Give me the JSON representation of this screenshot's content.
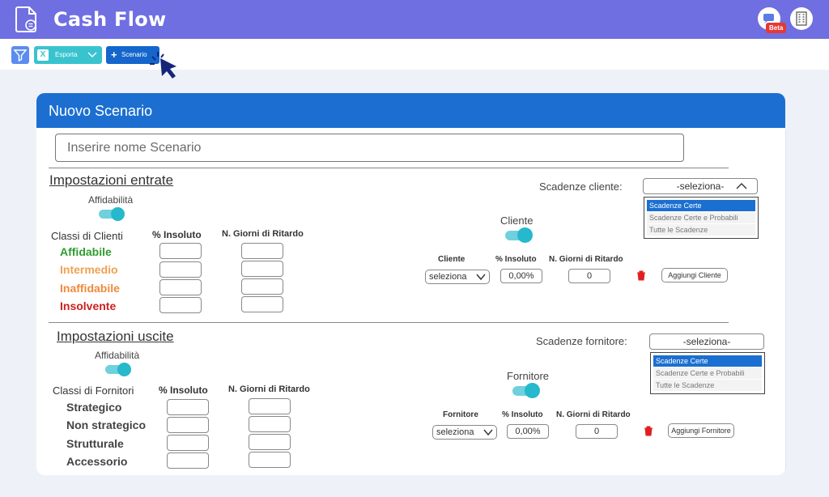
{
  "app": {
    "title": "Cash Flow",
    "beta_badge": "Beta"
  },
  "toolbar": {
    "export_label": "Esporta",
    "scenario_label": "Scenario"
  },
  "modal": {
    "title": "Nuovo Scenario",
    "name_placeholder": "Inserire nome Scenario",
    "entrate": {
      "heading": "Impostazioni entrate",
      "affidabilita_label": "Affidabilità",
      "col_classes": "Classi di Clienti",
      "col_insoluto": "% Insoluto",
      "col_ritardo": "N. Giorni di Ritardo",
      "classes": [
        "Affidabile",
        "Intermedio",
        "Inaffidabile",
        "Insolvente"
      ],
      "scadenze_label": "Scadenze cliente:",
      "scadenze_select": "-seleziona-",
      "scadenze_options": [
        "Scadenze Certe",
        "Scadenze Certe e Probabili",
        "Tutte le Scadenze"
      ],
      "party_label": "Cliente",
      "row_col_party": "Cliente",
      "row_col_insoluto": "% Insoluto",
      "row_col_ritardo": "N. Giorni di Ritardo",
      "row_select": "seleziona",
      "row_insoluto_value": "0,00%",
      "row_ritardo_value": "0",
      "add_label": "Aggiungi Cliente"
    },
    "uscite": {
      "heading": "Impostazioni uscite",
      "affidabilita_label": "Affidabilità",
      "col_classes": "Classi di Fornitori",
      "col_insoluto": "% Insoluto",
      "col_ritardo": "N. Giorni di Ritardo",
      "classes": [
        "Strategico",
        "Non strategico",
        "Strutturale",
        "Accessorio"
      ],
      "scadenze_label": "Scadenze fornitore:",
      "scadenze_select": "-seleziona-",
      "scadenze_options": [
        "Scadenze Certe",
        "Scadenze Certe e Probabili",
        "Tutte le Scadenze"
      ],
      "party_label": "Fornitore",
      "row_col_party": "Fornitore",
      "row_col_insoluto": "% Insoluto",
      "row_col_ritardo": "N. Giorni di Ritardo",
      "row_select": "seleziona",
      "row_insoluto_value": "0,00%",
      "row_ritardo_value": "0",
      "add_label": "Aggiungi Fornitore"
    }
  },
  "colors": {
    "header": "#6f6fe2",
    "modal_head": "#1c6fd1",
    "toggle": "#26b8cc",
    "affidabile": "#2e9e2e",
    "intermedio": "#f0a152",
    "inaffidabile": "#ee8a3a",
    "insolvente": "#cc1f1f"
  },
  "icons": [
    "document-icon",
    "chat-icon",
    "building-icon",
    "filter-icon",
    "excel-icon",
    "chevron-down-icon",
    "plus-icon",
    "cursor-icon",
    "chevron-up-icon",
    "trash-icon"
  ]
}
